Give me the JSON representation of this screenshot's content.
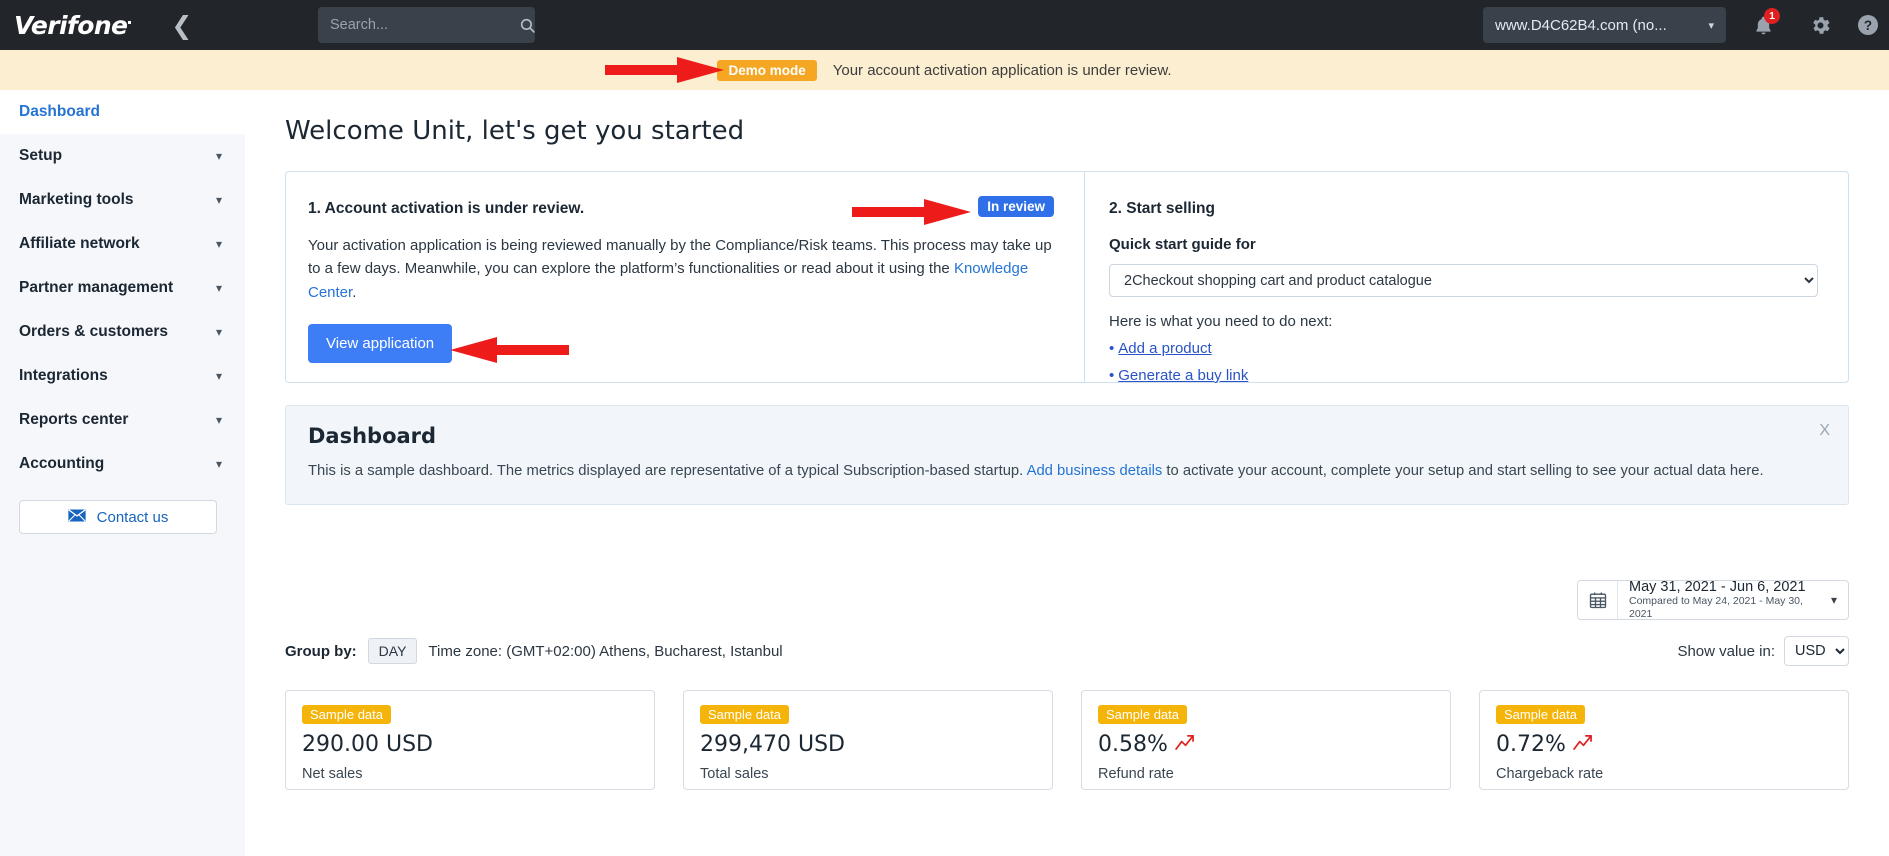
{
  "header": {
    "logo": "Verifone",
    "collapse_icon": "chevron-left-icon",
    "search_placeholder": "Search...",
    "search_value": "",
    "search_icon": "search-icon",
    "account": "www.D4C62B4.com (no...",
    "account_caret": "chevron-down-icon",
    "notification_icon": "bell-icon",
    "notification_count": "1",
    "settings_icon": "gear-icon",
    "help_icon": "help-icon",
    "bg_color": "#22262b"
  },
  "demo_banner": {
    "chip": "Demo mode",
    "chip_color": "#f5a623",
    "message": "Your account activation application is under review.",
    "bg_color": "#fcefd1"
  },
  "sidebar": {
    "items": [
      {
        "label": "Dashboard",
        "active": true,
        "caret": ""
      },
      {
        "label": "Setup",
        "active": false,
        "caret": "chevron-down-icon"
      },
      {
        "label": "Marketing tools",
        "active": false,
        "caret": "chevron-down-icon"
      },
      {
        "label": "Affiliate network",
        "active": false,
        "caret": "chevron-down-icon"
      },
      {
        "label": "Partner management",
        "active": false,
        "caret": "chevron-down-icon"
      },
      {
        "label": "Orders & customers",
        "active": false,
        "caret": "chevron-down-icon"
      },
      {
        "label": "Integrations",
        "active": false,
        "caret": "chevron-down-icon"
      },
      {
        "label": "Reports center",
        "active": false,
        "caret": "chevron-down-icon"
      },
      {
        "label": "Accounting",
        "active": false,
        "caret": "chevron-down-icon"
      }
    ],
    "contact_button": "Contact us",
    "contact_icon": "envelope-icon",
    "active_color": "#2574d4"
  },
  "main": {
    "page_title": "Welcome Unit, let's get you started",
    "onboarding": {
      "step1_title": "1. Account activation is under review.",
      "status_badge": "In review",
      "status_badge_color": "#2f70e8",
      "body_part1": "Your activation application is being reviewed manually by the Compliance/Risk teams. This process may take up to a few days. Meanwhile, you can explore the platform’s functionalities or read about it using the ",
      "body_link": "Knowledge Center",
      "body_part2": ".",
      "view_application_button": "View application",
      "step2_title": "2. Start selling",
      "quick_start_label": "Quick start guide for",
      "quick_start_selected": "2Checkout shopping cart and product catalogue",
      "next_intro": "Here is what you need to do next:",
      "next_links": [
        "Add a product",
        "Generate a buy link"
      ]
    },
    "dashboard_banner": {
      "title": "Dashboard",
      "text_part1": "This is a sample dashboard. The metrics displayed are representative of a typical Subscription-based startup. ",
      "link": "Add business details",
      "text_part2": " to activate your account, complete your setup and start selling to see your actual data here.",
      "close_label": "X"
    },
    "date_range": {
      "calendar_icon": "calendar-icon",
      "range": "May 31, 2021 - Jun 6, 2021",
      "compared": "Compared to May 24, 2021 - May 30, 2021",
      "caret": "chevron-down-icon"
    },
    "controls": {
      "group_by_label": "Group by:",
      "group_by_value": "DAY",
      "timezone": "Time zone: (GMT+02:00) Athens, Bucharest, Istanbul",
      "show_value_label": "Show value in:",
      "currency": "USD"
    },
    "metrics": [
      {
        "chip": "Sample data",
        "value": "290.00 USD",
        "label": "Net sales",
        "trend": ""
      },
      {
        "chip": "Sample data",
        "value": "299,470 USD",
        "label": "Total sales",
        "trend": ""
      },
      {
        "chip": "Sample data",
        "value": "0.58%",
        "label": "Refund rate",
        "trend": "trend-up-icon"
      },
      {
        "chip": "Sample data",
        "value": "0.72%",
        "label": "Chargeback rate",
        "trend": "trend-up-icon"
      }
    ]
  },
  "annotations": {
    "arrow_color": "#ee1b1b",
    "arrows": [
      {
        "name": "arrow-to-demo-mode",
        "direction": "right"
      },
      {
        "name": "arrow-to-in-review-badge",
        "direction": "right"
      },
      {
        "name": "arrow-to-view-application",
        "direction": "left"
      }
    ]
  }
}
